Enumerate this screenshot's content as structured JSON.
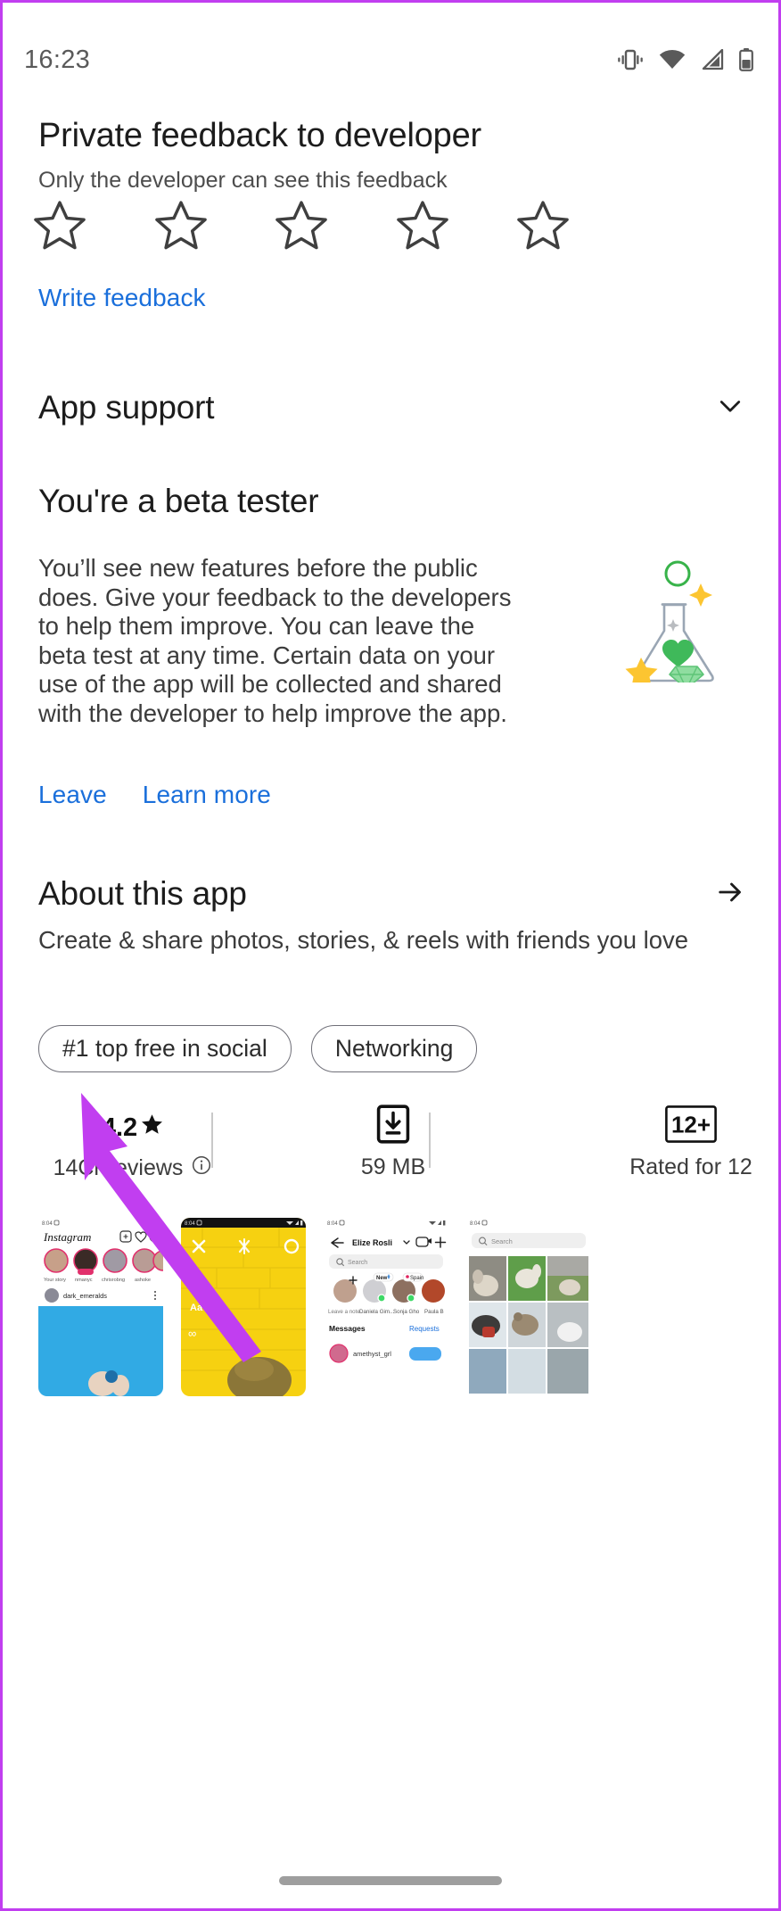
{
  "status_bar": {
    "time": "16:23",
    "icons": [
      "vibrate-icon",
      "wifi-icon",
      "cellular-signal-icon",
      "battery-icon"
    ]
  },
  "private_feedback": {
    "title": "Private feedback to developer",
    "subtitle": "Only the developer can see this feedback",
    "rating_value": 0,
    "star_count": 5,
    "write_feedback_label": "Write feedback"
  },
  "app_support": {
    "title": "App support",
    "expand_icon": "chevron-down-icon"
  },
  "beta_tester": {
    "title": "You're a beta tester",
    "body": "You’ll see new features before the public does. Give your feedback to the developers to help them improve. You can leave the beta test at any time. Certain data on your use of the app will be collected and shared with the developer to help improve the app.",
    "leave_label": "Leave",
    "learn_more_label": "Learn more",
    "illustration": "beaker-flask-illustration"
  },
  "about_this_app": {
    "title": "About this app",
    "arrow_icon": "arrow-right-icon",
    "description": "Create & share photos, stories, & reels with friends you love",
    "chips": [
      {
        "label": "#1 top free in social"
      },
      {
        "label": "Networking"
      }
    ]
  },
  "stats": [
    {
      "name": "rating",
      "value": "4.2",
      "value_icon": "star-filled-icon",
      "sub": "14Cr reviews",
      "sub_icon": "info-icon"
    },
    {
      "name": "download-size",
      "value": "",
      "value_icon": "download-box-icon",
      "sub": "59 MB",
      "sub_icon": ""
    },
    {
      "name": "content-rating",
      "value": "12+",
      "value_icon": "content-rating-badge",
      "sub": "Rated for 12",
      "sub_icon": ""
    }
  ],
  "screenshots": [
    {
      "name": "instagram-feed-screenshot",
      "time": "8:04",
      "app_name": "Instagram",
      "story_labels": [
        "Your story",
        "nmanyc",
        "chrisrobng",
        "ashoke"
      ],
      "post_user": "dark_emeralds"
    },
    {
      "name": "camera-story-screenshot",
      "time": "8:04"
    },
    {
      "name": "direct-messages-screenshot",
      "time": "8:04",
      "header": "Elize Rosli",
      "search_placeholder": "Search",
      "story_labels": [
        "Leave a note",
        "Daniela Gim...",
        "Sonja Gho",
        "Paula B"
      ],
      "badges": [
        "New",
        "Spain"
      ],
      "messages_label": "Messages",
      "requests_label": "Requests",
      "message_user": "amethyst_grl"
    },
    {
      "name": "explore-grid-screenshot",
      "time": "8:04",
      "search_placeholder": "Search"
    }
  ],
  "annotation": {
    "type": "arrow-pointer",
    "color": "#c13ef0",
    "points_to": "leave-link"
  },
  "colors": {
    "link_blue": "#1a6fdb",
    "annotation_purple": "#c13ef0",
    "text_primary": "#1c1c1c",
    "text_secondary": "#4d4d4d",
    "chip_border": "#6f6f78"
  },
  "nav_handle": "home-indicator"
}
